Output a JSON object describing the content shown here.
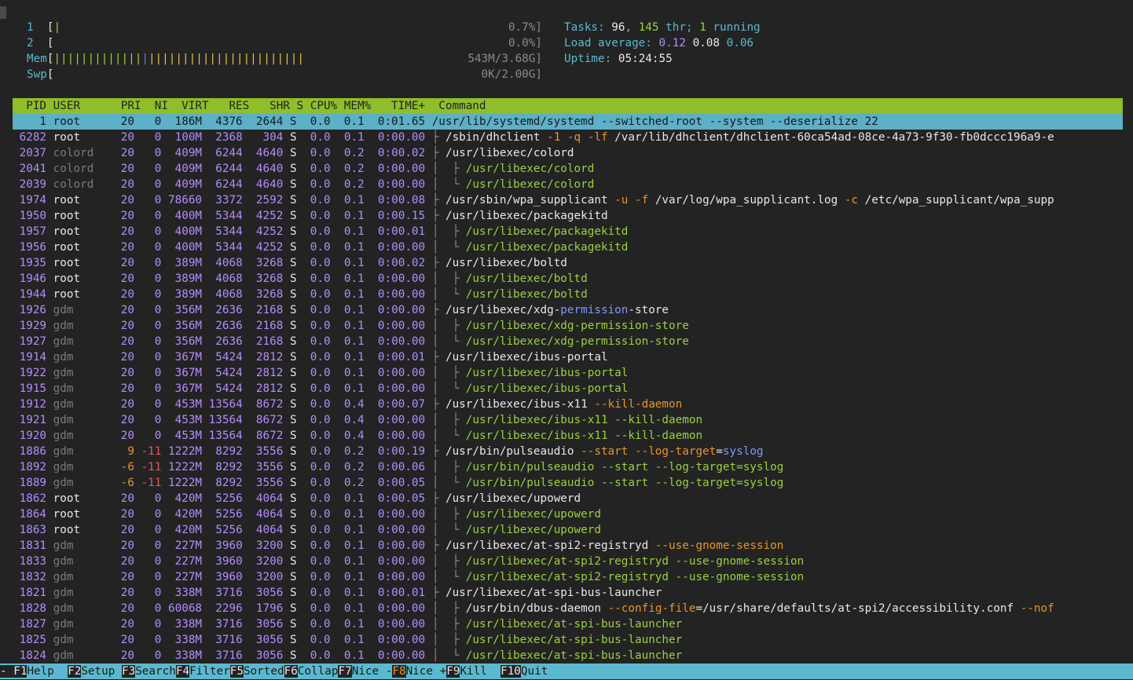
{
  "meters": {
    "cpu1": {
      "label": "1",
      "bar": "[|",
      "value": "0.7%]"
    },
    "cpu2": {
      "label": "2",
      "bar": "[",
      "value": "0.0%]"
    },
    "mem": {
      "label": "Mem",
      "bar_open": "[",
      "bar_fill_green": "|||||||||||||",
      "bar_fill_blue": "|",
      "bar_fill_yellow": "|||||||||||||||||||||||",
      "value": "543M/3.68G]"
    },
    "swp": {
      "label": "Swp",
      "bar": "[",
      "value": "0K/2.00G]"
    }
  },
  "tasks": {
    "label": "Tasks:",
    "tasks": "96",
    "sep": ",",
    "threads": "145",
    "thr_label": "thr;",
    "running": "1",
    "running_label": "running"
  },
  "load": {
    "label": "Load average:",
    "l1": "0.12",
    "l5": "0.08",
    "l15": "0.06"
  },
  "uptime": {
    "label": "Uptime:",
    "value": "05:24:55"
  },
  "columns": "  PID USER      PRI  NI  VIRT   RES   SHR S CPU% MEM%   TIME+  Command",
  "selected": {
    "pid": "1",
    "user": "root",
    "pri": "20",
    "ni": "0",
    "virt": "186M",
    "res": "4376",
    "shr": "2644",
    "s": "S",
    "cpu": "0.0",
    "mem": "0.1",
    "time": "0:01.65",
    "cmd": "/usr/lib/systemd/systemd --switched-root --system --deserialize 22"
  },
  "processes": [
    {
      "pid": "6282",
      "user": "root",
      "pri": "20",
      "ni": "0",
      "virt": "100M",
      "res": "2368",
      "shr": "304",
      "s": "S",
      "cpu": "0.0",
      "mem": "0.1",
      "time": "0:00.00",
      "tree": "├ ",
      "cmd": [
        [
          "/sbin/dhclient ",
          "w"
        ],
        [
          "-1 -q -lf ",
          "o"
        ],
        [
          "/var/lib/dhclient/dhclient-60ca54ad-08ce-4a73-9f30-fb0dccc196a9-e",
          "w"
        ]
      ]
    },
    {
      "pid": "2037",
      "user": "colord",
      "pri": "20",
      "ni": "0",
      "virt": "409M",
      "res": "6244",
      "shr": "4640",
      "s": "S",
      "cpu": "0.0",
      "mem": "0.2",
      "time": "0:00.02",
      "tree": "├ ",
      "cmd": [
        [
          "/usr/libexec/colord",
          "w"
        ]
      ]
    },
    {
      "pid": "2041",
      "user": "colord",
      "pri": "20",
      "ni": "0",
      "virt": "409M",
      "res": "6244",
      "shr": "4640",
      "s": "S",
      "cpu": "0.0",
      "mem": "0.2",
      "time": "0:00.00",
      "tree": "│  ├ ",
      "cmd": [
        [
          "/usr/libexec/colord",
          "g"
        ]
      ]
    },
    {
      "pid": "2039",
      "user": "colord",
      "pri": "20",
      "ni": "0",
      "virt": "409M",
      "res": "6244",
      "shr": "4640",
      "s": "S",
      "cpu": "0.0",
      "mem": "0.2",
      "time": "0:00.00",
      "tree": "│  └ ",
      "cmd": [
        [
          "/usr/libexec/colord",
          "g"
        ]
      ]
    },
    {
      "pid": "1974",
      "user": "root",
      "pri": "20",
      "ni": "0",
      "virt": "78660",
      "res": "3372",
      "shr": "2592",
      "s": "S",
      "cpu": "0.0",
      "mem": "0.1",
      "time": "0:00.08",
      "tree": "├ ",
      "cmd": [
        [
          "/usr/sbin/wpa_supplicant ",
          "w"
        ],
        [
          "-u -f ",
          "o"
        ],
        [
          "/var/log/wpa_supplicant.log ",
          "w"
        ],
        [
          "-c ",
          "o"
        ],
        [
          "/etc/wpa_supplicant/wpa_supp",
          "w"
        ]
      ]
    },
    {
      "pid": "1950",
      "user": "root",
      "pri": "20",
      "ni": "0",
      "virt": "400M",
      "res": "5344",
      "shr": "4252",
      "s": "S",
      "cpu": "0.0",
      "mem": "0.1",
      "time": "0:00.15",
      "tree": "├ ",
      "cmd": [
        [
          "/usr/libexec/packagekitd",
          "w"
        ]
      ]
    },
    {
      "pid": "1957",
      "user": "root",
      "pri": "20",
      "ni": "0",
      "virt": "400M",
      "res": "5344",
      "shr": "4252",
      "s": "S",
      "cpu": "0.0",
      "mem": "0.1",
      "time": "0:00.01",
      "tree": "│  ├ ",
      "cmd": [
        [
          "/usr/libexec/packagekitd",
          "g"
        ]
      ]
    },
    {
      "pid": "1956",
      "user": "root",
      "pri": "20",
      "ni": "0",
      "virt": "400M",
      "res": "5344",
      "shr": "4252",
      "s": "S",
      "cpu": "0.0",
      "mem": "0.1",
      "time": "0:00.00",
      "tree": "│  └ ",
      "cmd": [
        [
          "/usr/libexec/packagekitd",
          "g"
        ]
      ]
    },
    {
      "pid": "1935",
      "user": "root",
      "pri": "20",
      "ni": "0",
      "virt": "389M",
      "res": "4068",
      "shr": "3268",
      "s": "S",
      "cpu": "0.0",
      "mem": "0.1",
      "time": "0:00.02",
      "tree": "├ ",
      "cmd": [
        [
          "/usr/libexec/boltd",
          "w"
        ]
      ]
    },
    {
      "pid": "1946",
      "user": "root",
      "pri": "20",
      "ni": "0",
      "virt": "389M",
      "res": "4068",
      "shr": "3268",
      "s": "S",
      "cpu": "0.0",
      "mem": "0.1",
      "time": "0:00.00",
      "tree": "│  ├ ",
      "cmd": [
        [
          "/usr/libexec/boltd",
          "g"
        ]
      ]
    },
    {
      "pid": "1944",
      "user": "root",
      "pri": "20",
      "ni": "0",
      "virt": "389M",
      "res": "4068",
      "shr": "3268",
      "s": "S",
      "cpu": "0.0",
      "mem": "0.1",
      "time": "0:00.00",
      "tree": "│  └ ",
      "cmd": [
        [
          "/usr/libexec/boltd",
          "g"
        ]
      ]
    },
    {
      "pid": "1926",
      "user": "gdm",
      "pri": "20",
      "ni": "0",
      "virt": "356M",
      "res": "2636",
      "shr": "2168",
      "s": "S",
      "cpu": "0.0",
      "mem": "0.1",
      "time": "0:00.00",
      "tree": "├ ",
      "cmd": [
        [
          "/usr/libexec/xdg-",
          "w"
        ],
        [
          "permission",
          "b"
        ],
        [
          "-store",
          "w"
        ]
      ]
    },
    {
      "pid": "1929",
      "user": "gdm",
      "pri": "20",
      "ni": "0",
      "virt": "356M",
      "res": "2636",
      "shr": "2168",
      "s": "S",
      "cpu": "0.0",
      "mem": "0.1",
      "time": "0:00.00",
      "tree": "│  ├ ",
      "cmd": [
        [
          "/usr/libexec/xdg-permission-store",
          "g"
        ]
      ]
    },
    {
      "pid": "1927",
      "user": "gdm",
      "pri": "20",
      "ni": "0",
      "virt": "356M",
      "res": "2636",
      "shr": "2168",
      "s": "S",
      "cpu": "0.0",
      "mem": "0.1",
      "time": "0:00.00",
      "tree": "│  └ ",
      "cmd": [
        [
          "/usr/libexec/xdg-permission-store",
          "g"
        ]
      ]
    },
    {
      "pid": "1914",
      "user": "gdm",
      "pri": "20",
      "ni": "0",
      "virt": "367M",
      "res": "5424",
      "shr": "2812",
      "s": "S",
      "cpu": "0.0",
      "mem": "0.1",
      "time": "0:00.01",
      "tree": "├ ",
      "cmd": [
        [
          "/usr/libexec/ibus-portal",
          "w"
        ]
      ]
    },
    {
      "pid": "1922",
      "user": "gdm",
      "pri": "20",
      "ni": "0",
      "virt": "367M",
      "res": "5424",
      "shr": "2812",
      "s": "S",
      "cpu": "0.0",
      "mem": "0.1",
      "time": "0:00.00",
      "tree": "│  ├ ",
      "cmd": [
        [
          "/usr/libexec/ibus-portal",
          "g"
        ]
      ]
    },
    {
      "pid": "1915",
      "user": "gdm",
      "pri": "20",
      "ni": "0",
      "virt": "367M",
      "res": "5424",
      "shr": "2812",
      "s": "S",
      "cpu": "0.0",
      "mem": "0.1",
      "time": "0:00.00",
      "tree": "│  └ ",
      "cmd": [
        [
          "/usr/libexec/ibus-portal",
          "g"
        ]
      ]
    },
    {
      "pid": "1912",
      "user": "gdm",
      "pri": "20",
      "ni": "0",
      "virt": "453M",
      "res": "13564",
      "shr": "8672",
      "s": "S",
      "cpu": "0.0",
      "mem": "0.4",
      "time": "0:00.07",
      "tree": "├ ",
      "cmd": [
        [
          "/usr/libexec/ibus-x11 ",
          "w"
        ],
        [
          "--kill-daemon",
          "o"
        ]
      ]
    },
    {
      "pid": "1921",
      "user": "gdm",
      "pri": "20",
      "ni": "0",
      "virt": "453M",
      "res": "13564",
      "shr": "8672",
      "s": "S",
      "cpu": "0.0",
      "mem": "0.4",
      "time": "0:00.00",
      "tree": "│  ├ ",
      "cmd": [
        [
          "/usr/libexec/ibus-x11 --kill-daemon",
          "g"
        ]
      ]
    },
    {
      "pid": "1920",
      "user": "gdm",
      "pri": "20",
      "ni": "0",
      "virt": "453M",
      "res": "13564",
      "shr": "8672",
      "s": "S",
      "cpu": "0.0",
      "mem": "0.4",
      "time": "0:00.00",
      "tree": "│  └ ",
      "cmd": [
        [
          "/usr/libexec/ibus-x11 --kill-daemon",
          "g"
        ]
      ]
    },
    {
      "pid": "1886",
      "user": "gdm",
      "pri": "9",
      "ni": "-11",
      "virt": "1222M",
      "res": "8292",
      "shr": "3556",
      "s": "S",
      "cpu": "0.0",
      "mem": "0.2",
      "time": "0:00.19",
      "tree": "├ ",
      "cmd": [
        [
          "/usr/bin/pulseaudio ",
          "w"
        ],
        [
          "--start --log-target",
          "o"
        ],
        [
          "=",
          "w"
        ],
        [
          "syslog",
          "b"
        ]
      ]
    },
    {
      "pid": "1892",
      "user": "gdm",
      "pri": "-6",
      "ni": "-11",
      "virt": "1222M",
      "res": "8292",
      "shr": "3556",
      "s": "S",
      "cpu": "0.0",
      "mem": "0.2",
      "time": "0:00.06",
      "tree": "│  ├ ",
      "cmd": [
        [
          "/usr/bin/pulseaudio --start --log-target=syslog",
          "g"
        ]
      ]
    },
    {
      "pid": "1889",
      "user": "gdm",
      "pri": "-6",
      "ni": "-11",
      "virt": "1222M",
      "res": "8292",
      "shr": "3556",
      "s": "S",
      "cpu": "0.0",
      "mem": "0.2",
      "time": "0:00.05",
      "tree": "│  └ ",
      "cmd": [
        [
          "/usr/bin/pulseaudio --start --log-target=syslog",
          "g"
        ]
      ]
    },
    {
      "pid": "1862",
      "user": "root",
      "pri": "20",
      "ni": "0",
      "virt": "420M",
      "res": "5256",
      "shr": "4064",
      "s": "S",
      "cpu": "0.0",
      "mem": "0.1",
      "time": "0:00.05",
      "tree": "├ ",
      "cmd": [
        [
          "/usr/libexec/upowerd",
          "w"
        ]
      ]
    },
    {
      "pid": "1864",
      "user": "root",
      "pri": "20",
      "ni": "0",
      "virt": "420M",
      "res": "5256",
      "shr": "4064",
      "s": "S",
      "cpu": "0.0",
      "mem": "0.1",
      "time": "0:00.00",
      "tree": "│  ├ ",
      "cmd": [
        [
          "/usr/libexec/upowerd",
          "g"
        ]
      ]
    },
    {
      "pid": "1863",
      "user": "root",
      "pri": "20",
      "ni": "0",
      "virt": "420M",
      "res": "5256",
      "shr": "4064",
      "s": "S",
      "cpu": "0.0",
      "mem": "0.1",
      "time": "0:00.00",
      "tree": "│  └ ",
      "cmd": [
        [
          "/usr/libexec/upowerd",
          "g"
        ]
      ]
    },
    {
      "pid": "1831",
      "user": "gdm",
      "pri": "20",
      "ni": "0",
      "virt": "227M",
      "res": "3960",
      "shr": "3200",
      "s": "S",
      "cpu": "0.0",
      "mem": "0.1",
      "time": "0:00.00",
      "tree": "├ ",
      "cmd": [
        [
          "/usr/libexec/at-spi2-registryd ",
          "w"
        ],
        [
          "--use-gnome-session",
          "o"
        ]
      ]
    },
    {
      "pid": "1833",
      "user": "gdm",
      "pri": "20",
      "ni": "0",
      "virt": "227M",
      "res": "3960",
      "shr": "3200",
      "s": "S",
      "cpu": "0.0",
      "mem": "0.1",
      "time": "0:00.00",
      "tree": "│  ├ ",
      "cmd": [
        [
          "/usr/libexec/at-spi2-registryd --use-gnome-session",
          "g"
        ]
      ]
    },
    {
      "pid": "1832",
      "user": "gdm",
      "pri": "20",
      "ni": "0",
      "virt": "227M",
      "res": "3960",
      "shr": "3200",
      "s": "S",
      "cpu": "0.0",
      "mem": "0.1",
      "time": "0:00.00",
      "tree": "│  └ ",
      "cmd": [
        [
          "/usr/libexec/at-spi2-registryd --use-gnome-session",
          "g"
        ]
      ]
    },
    {
      "pid": "1821",
      "user": "gdm",
      "pri": "20",
      "ni": "0",
      "virt": "338M",
      "res": "3716",
      "shr": "3056",
      "s": "S",
      "cpu": "0.0",
      "mem": "0.1",
      "time": "0:00.01",
      "tree": "├ ",
      "cmd": [
        [
          "/usr/libexec/at-spi-bus-launcher",
          "w"
        ]
      ]
    },
    {
      "pid": "1828",
      "user": "gdm",
      "pri": "20",
      "ni": "0",
      "virt": "60068",
      "res": "2296",
      "shr": "1796",
      "s": "S",
      "cpu": "0.0",
      "mem": "0.1",
      "time": "0:00.00",
      "tree": "│  ├ ",
      "cmd": [
        [
          "/usr/bin/dbus-daemon ",
          "w"
        ],
        [
          "--config-file",
          "o"
        ],
        [
          "=/usr/share/defaults/at-spi2/accessibility.conf ",
          "w"
        ],
        [
          "--nof",
          "o"
        ]
      ]
    },
    {
      "pid": "1827",
      "user": "gdm",
      "pri": "20",
      "ni": "0",
      "virt": "338M",
      "res": "3716",
      "shr": "3056",
      "s": "S",
      "cpu": "0.0",
      "mem": "0.1",
      "time": "0:00.00",
      "tree": "│  ├ ",
      "cmd": [
        [
          "/usr/libexec/at-spi-bus-launcher",
          "g"
        ]
      ]
    },
    {
      "pid": "1825",
      "user": "gdm",
      "pri": "20",
      "ni": "0",
      "virt": "338M",
      "res": "3716",
      "shr": "3056",
      "s": "S",
      "cpu": "0.0",
      "mem": "0.1",
      "time": "0:00.00",
      "tree": "│  ├ ",
      "cmd": [
        [
          "/usr/libexec/at-spi-bus-launcher",
          "g"
        ]
      ]
    },
    {
      "pid": "1824",
      "user": "gdm",
      "pri": "20",
      "ni": "0",
      "virt": "338M",
      "res": "3716",
      "shr": "3056",
      "s": "S",
      "cpu": "0.0",
      "mem": "0.1",
      "time": "0:00.00",
      "tree": "│  └ ",
      "cmd": [
        [
          "/usr/libexec/at-spi-bus-launcher",
          "g"
        ]
      ]
    }
  ],
  "footer": [
    {
      "key": "F1",
      "label": "Help  "
    },
    {
      "key": "F2",
      "label": "Setup "
    },
    {
      "key": "F3",
      "label": "Search"
    },
    {
      "key": "F4",
      "label": "Filter"
    },
    {
      "key": "F5",
      "label": "Sorted"
    },
    {
      "key": "F6",
      "label": "Collap"
    },
    {
      "key": "F7",
      "label": "Nice -"
    },
    {
      "key": "F8",
      "label": "Nice +"
    },
    {
      "key": "F9",
      "label": "Kill  "
    },
    {
      "key": "F10",
      "label": "Quit"
    }
  ],
  "footer_left": "-",
  "colors": {
    "header_bg": "#8fbe2a",
    "selected_bg": "#5cb0c8",
    "footer_bg": "#5ab9cf",
    "background": "#232323"
  }
}
